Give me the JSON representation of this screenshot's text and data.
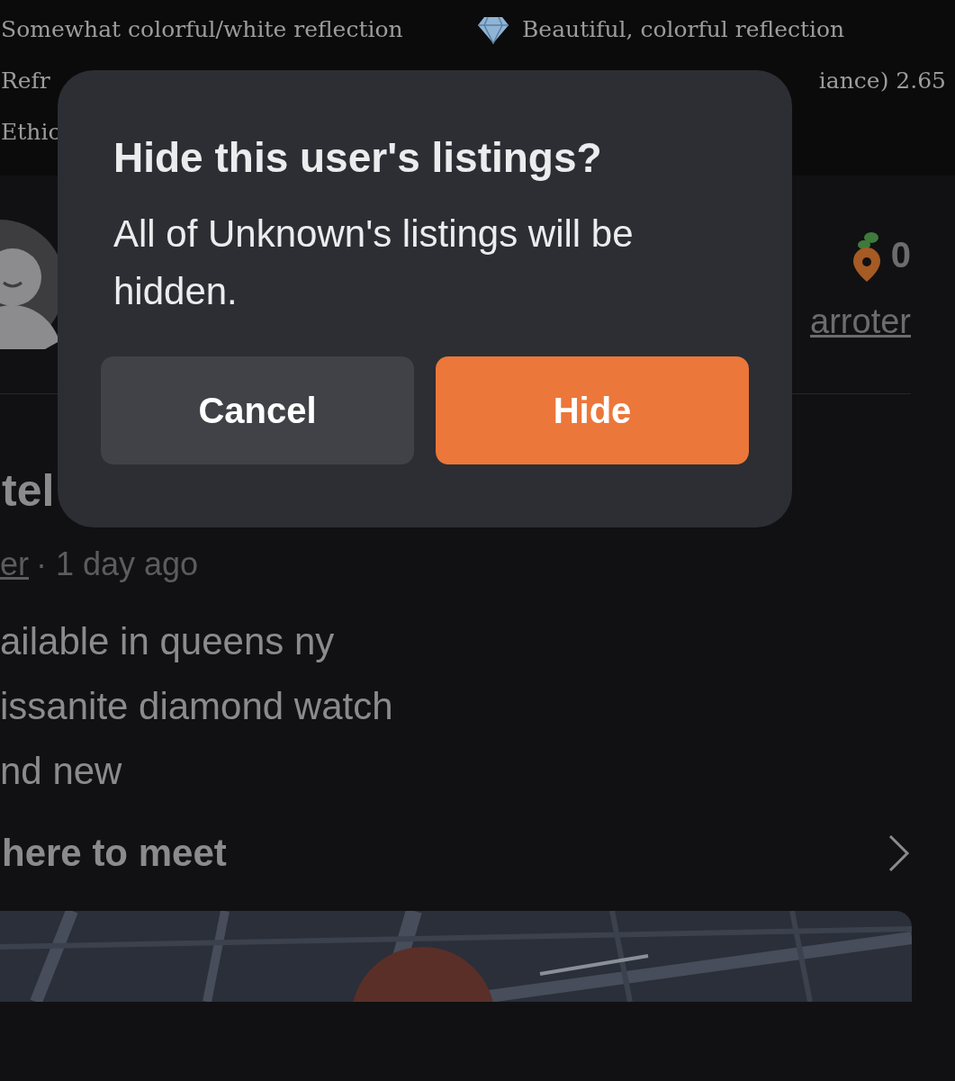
{
  "comparison": {
    "rows": [
      {
        "left": "Somewhat colorful/white reflection",
        "right": "Beautiful, colorful reflection",
        "right_icon": true
      },
      {
        "left": "Refr",
        "right": "iance) 2.65"
      },
      {
        "left": "Ethic"
      }
    ]
  },
  "seller": {
    "karma": "0",
    "username": "arroter"
  },
  "listing": {
    "title": "tel",
    "seller_link": "er",
    "posted": "· 1 day ago",
    "description": [
      "ailable in queens ny",
      "issanite diamond watch",
      "nd new"
    ],
    "meet_heading": "here to meet"
  },
  "dialog": {
    "title": "Hide this user's listings?",
    "message": "All of Unknown's listings will be hidden.",
    "buttons": [
      {
        "label": "Cancel",
        "kind": "secondary"
      },
      {
        "label": "Hide",
        "kind": "primary"
      }
    ]
  }
}
